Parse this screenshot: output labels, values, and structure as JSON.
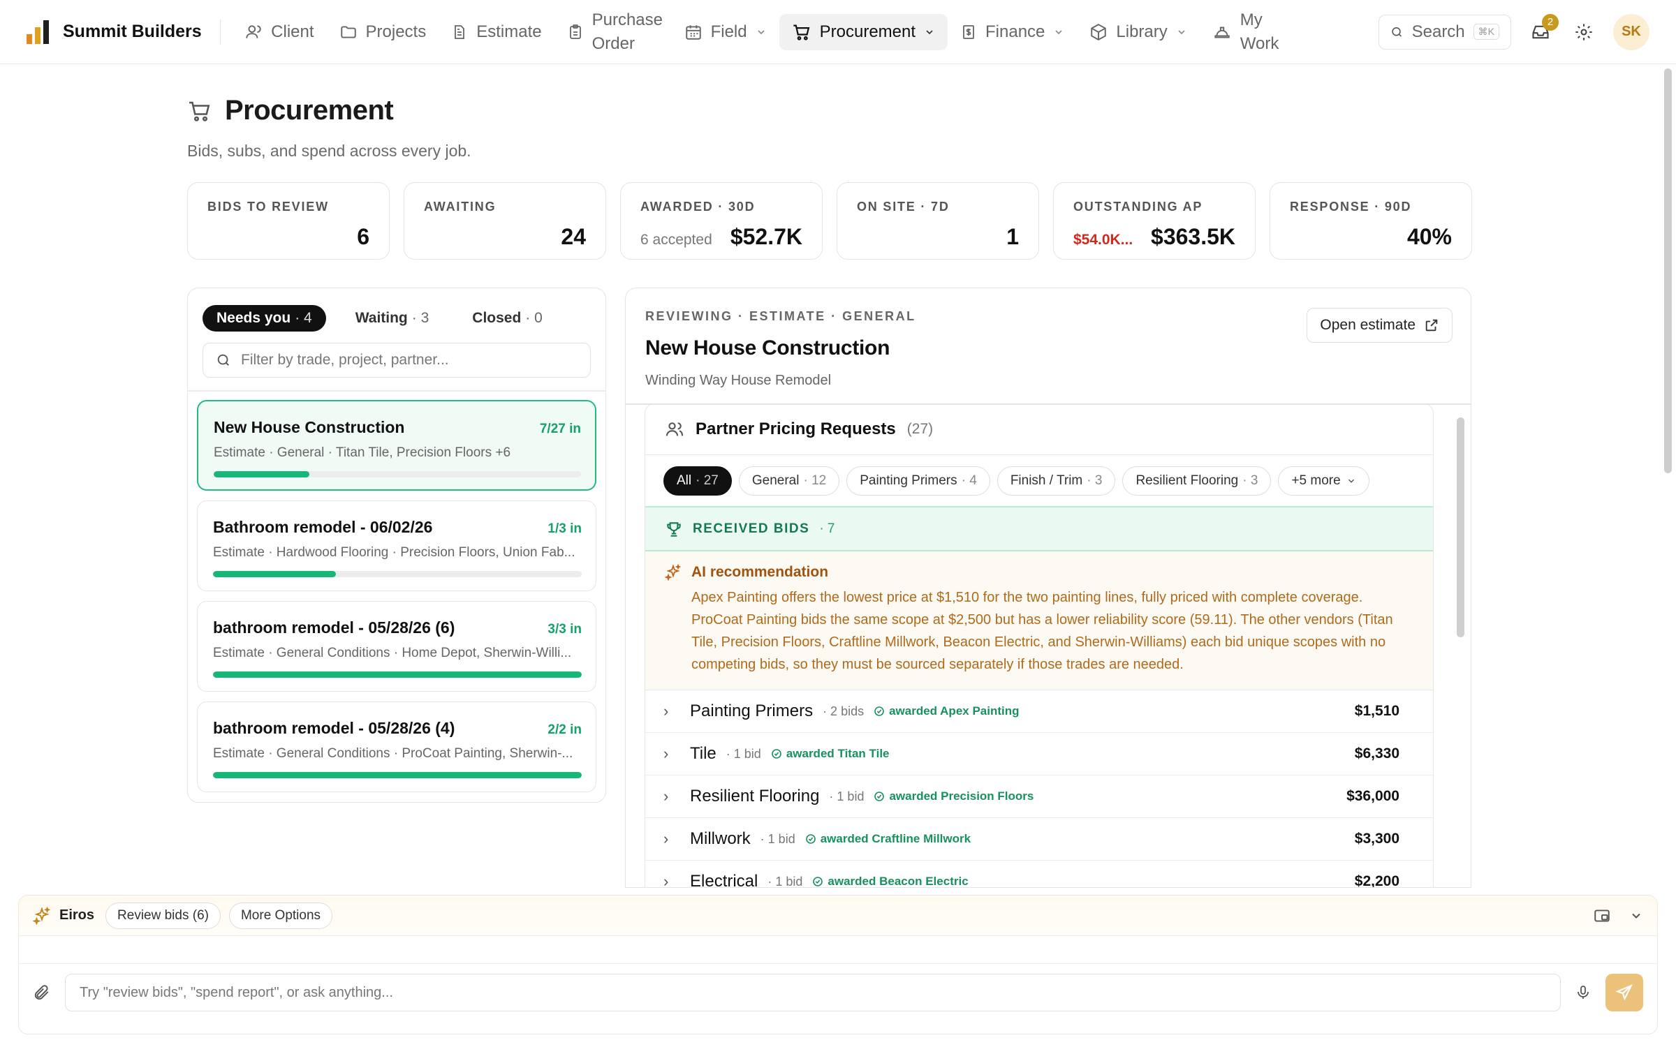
{
  "brand": {
    "name": "Summit Builders"
  },
  "nav": {
    "items": [
      {
        "label": "Client"
      },
      {
        "label": "Projects"
      },
      {
        "label": "Estimate"
      },
      {
        "label": "Purchase Order"
      },
      {
        "label": "Field"
      },
      {
        "label": "Procurement"
      },
      {
        "label": "Finance"
      },
      {
        "label": "Library"
      },
      {
        "label": "My Work"
      }
    ],
    "search_label": "Search",
    "search_kbd": "⌘K",
    "notifications": "2",
    "avatar": "SK"
  },
  "page": {
    "title": "Procurement",
    "subtitle": "Bids, subs, and spend across every job."
  },
  "kpis": [
    {
      "label": "BIDS TO REVIEW",
      "note": "",
      "value": "6"
    },
    {
      "label": "AWAITING",
      "note": "",
      "value": "24"
    },
    {
      "label": "AWARDED · 30D",
      "note": "6 accepted",
      "value": "$52.7K"
    },
    {
      "label": "ON SITE · 7D",
      "note": "",
      "value": "1"
    },
    {
      "label": "OUTSTANDING AP",
      "note": "$54.0K...",
      "value": "$363.5K"
    },
    {
      "label": "RESPONSE · 90D",
      "note": "",
      "value": "40%"
    }
  ],
  "left": {
    "tabs": [
      {
        "label": "Needs you",
        "count": "· 4"
      },
      {
        "label": "Waiting",
        "count": "· 3"
      },
      {
        "label": "Closed",
        "count": "· 0"
      }
    ],
    "filter_placeholder": "Filter by trade, project, partner...",
    "cards": [
      {
        "title": "New House Construction",
        "count": "7/27 in",
        "meta": "Estimate · General · Titan Tile, Precision Floors +6",
        "progress": 0.26
      },
      {
        "title": "Bathroom remodel - 06/02/26",
        "count": "1/3 in",
        "meta": "Estimate · Hardwood Flooring · Precision Floors, Union Fab...",
        "progress": 0.333
      },
      {
        "title": "bathroom remodel - 05/28/26 (6)",
        "count": "3/3 in",
        "meta": "Estimate · General Conditions · Home Depot, Sherwin-Willi...",
        "progress": 1.0
      },
      {
        "title": "bathroom remodel - 05/28/26 (4)",
        "count": "2/2 in",
        "meta": "Estimate · General Conditions · ProCoat Painting, Sherwin-...",
        "progress": 1.0
      }
    ]
  },
  "right": {
    "crumb": "REVIEWING · ESTIMATE · GENERAL",
    "title": "New House Construction",
    "subtitle": "Winding Way House Remodel",
    "open_label": "Open estimate",
    "section_title": "Partner Pricing Requests",
    "section_count": "(27)",
    "chips": [
      {
        "label": "All",
        "count": "· 27"
      },
      {
        "label": "General",
        "count": "· 12"
      },
      {
        "label": "Painting Primers",
        "count": "· 4"
      },
      {
        "label": "Finish / Trim",
        "count": "· 3"
      },
      {
        "label": "Resilient Flooring",
        "count": "· 3"
      },
      {
        "label": "+5 more",
        "count": ""
      }
    ],
    "received_label": "RECEIVED BIDS",
    "received_count": "· 7",
    "ai_title": "AI recommendation",
    "ai_text": "Apex Painting offers the lowest price at $1,510 for the two painting lines, fully priced with complete coverage. ProCoat Painting bids the same scope at $2,500 but has a lower reliability score (59.11). The other vendors (Titan Tile, Precision Floors, Craftline Millwork, Beacon Electric, and Sherwin-Williams) each bid unique scopes with no competing bids, so they must be sourced separately if those trades are needed.",
    "bids": [
      {
        "name": "Painting Primers",
        "count": "· 2 bids",
        "award": "awarded Apex Painting",
        "amount": "$1,510"
      },
      {
        "name": "Tile",
        "count": "· 1 bid",
        "award": "awarded Titan Tile",
        "amount": "$6,330"
      },
      {
        "name": "Resilient Flooring",
        "count": "· 1 bid",
        "award": "awarded Precision Floors",
        "amount": "$36,000"
      },
      {
        "name": "Millwork",
        "count": "· 1 bid",
        "award": "awarded Craftline Millwork",
        "amount": "$3,300"
      },
      {
        "name": "Electrical",
        "count": "· 1 bid",
        "award": "awarded Beacon Electric",
        "amount": "$2,200"
      }
    ]
  },
  "dock": {
    "name": "Eiros",
    "chips": [
      "Review bids (6)",
      "More Options"
    ],
    "input_placeholder": "Try \"review bids\", \"spend report\", or ask anything..."
  },
  "colors": {
    "accent_green": "#16b779",
    "brand_gold": "#c79a1e",
    "ai_text": "#b06a1c",
    "warning_red": "#d0281a"
  }
}
